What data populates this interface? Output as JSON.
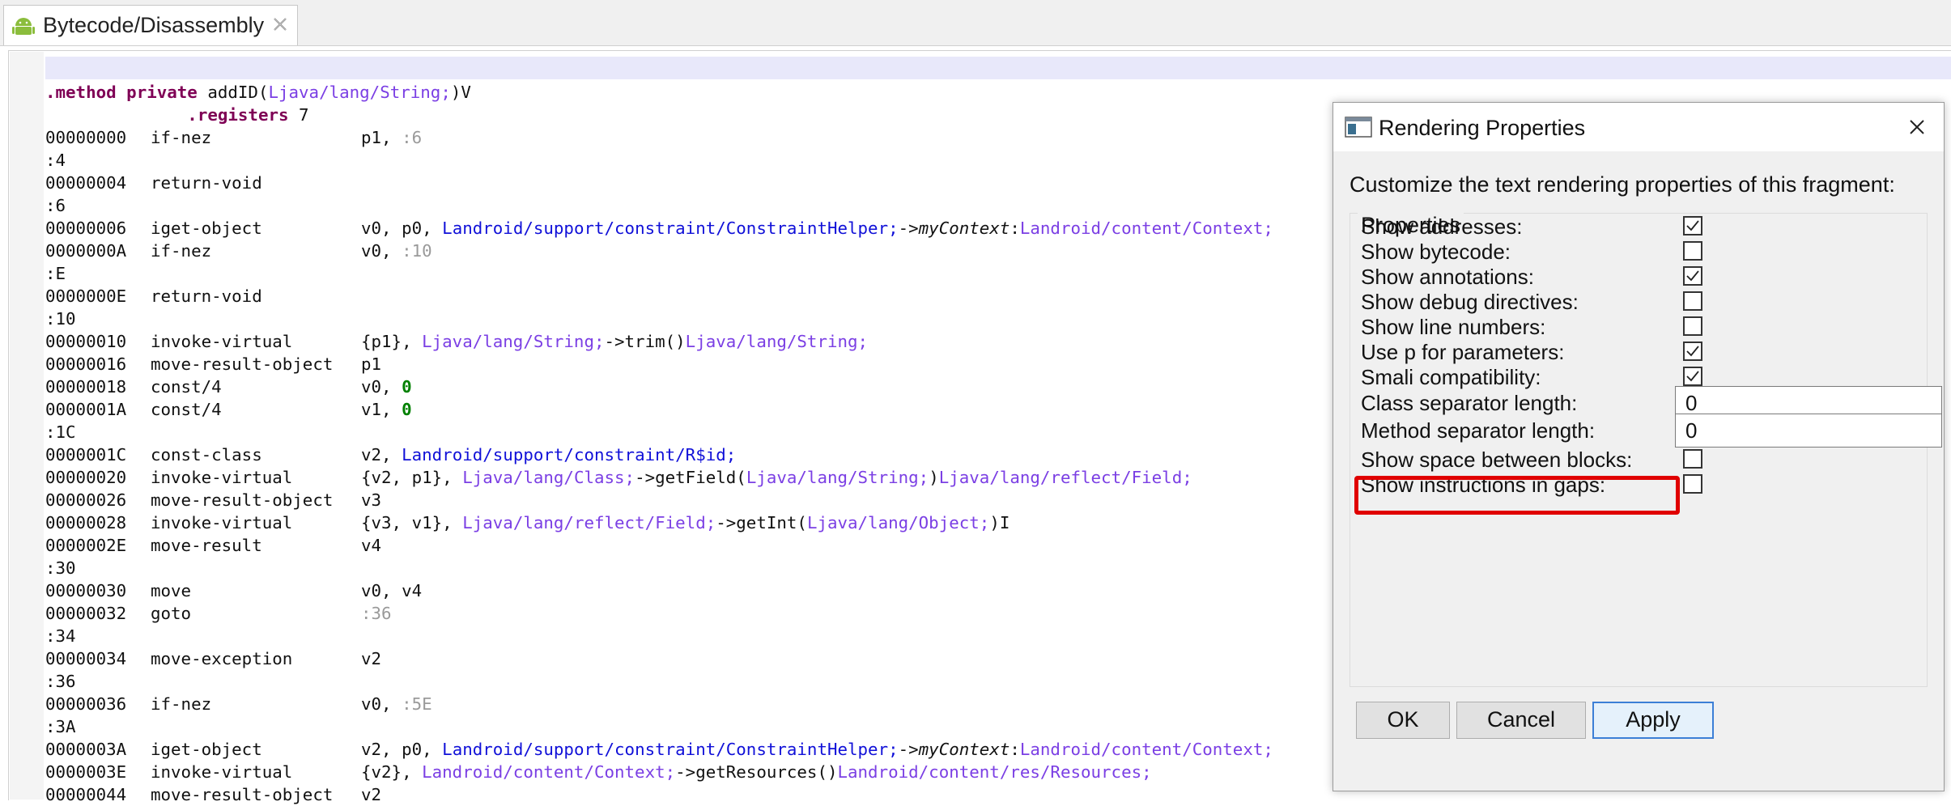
{
  "tab": {
    "title": "Bytecode/Disassembly"
  },
  "code": {
    "lines": [
      [
        {
          "t": ".method ",
          "c": "kw"
        },
        {
          "t": "private ",
          "c": "kw"
        },
        {
          "t": "addID("
        },
        {
          "t": "Ljava/lang/String;",
          "c": "type"
        },
        {
          "t": ")V"
        }
      ],
      [
        {
          "t": "              "
        },
        {
          "t": ".registers ",
          "c": "kw"
        },
        {
          "t": "7"
        }
      ],
      [
        {
          "t": "00000000",
          "c": "addr"
        },
        {
          "t": "if-nez",
          "c": "op"
        },
        {
          "t": "p1, "
        },
        {
          "t": ":6",
          "c": "lbl"
        }
      ],
      [
        {
          "t": ":4"
        }
      ],
      [
        {
          "t": "00000004",
          "c": "addr"
        },
        {
          "t": "return-void",
          "c": "op"
        }
      ],
      [
        {
          "t": ":6"
        }
      ],
      [
        {
          "t": "00000006",
          "c": "addr"
        },
        {
          "t": "iget-object",
          "c": "op"
        },
        {
          "t": "v0, p0, "
        },
        {
          "t": "Landroid/support/constraint/ConstraintHelper;",
          "c": "cls"
        },
        {
          "t": "->"
        },
        {
          "t": "myContext",
          "c": "fld"
        },
        {
          "t": ":"
        },
        {
          "t": "Landroid/content/Context;",
          "c": "type"
        }
      ],
      [
        {
          "t": "0000000A",
          "c": "addr"
        },
        {
          "t": "if-nez",
          "c": "op"
        },
        {
          "t": "v0, "
        },
        {
          "t": ":10",
          "c": "lbl"
        }
      ],
      [
        {
          "t": ":E"
        }
      ],
      [
        {
          "t": "0000000E",
          "c": "addr"
        },
        {
          "t": "return-void",
          "c": "op"
        }
      ],
      [
        {
          "t": ":10"
        }
      ],
      [
        {
          "t": "00000010",
          "c": "addr"
        },
        {
          "t": "invoke-virtual",
          "c": "op"
        },
        {
          "t": "{p1}, "
        },
        {
          "t": "Ljava/lang/String;",
          "c": "type"
        },
        {
          "t": "->trim()"
        },
        {
          "t": "Ljava/lang/String;",
          "c": "type"
        }
      ],
      [
        {
          "t": "00000016",
          "c": "addr"
        },
        {
          "t": "move-result-object",
          "c": "op"
        },
        {
          "t": "p1"
        }
      ],
      [
        {
          "t": "00000018",
          "c": "addr"
        },
        {
          "t": "const/4",
          "c": "op"
        },
        {
          "t": "v0, "
        },
        {
          "t": "0",
          "c": "num"
        }
      ],
      [
        {
          "t": "0000001A",
          "c": "addr"
        },
        {
          "t": "const/4",
          "c": "op"
        },
        {
          "t": "v1, "
        },
        {
          "t": "0",
          "c": "num"
        }
      ],
      [
        {
          "t": ":1C"
        }
      ],
      [
        {
          "t": "0000001C",
          "c": "addr"
        },
        {
          "t": "const-class",
          "c": "op"
        },
        {
          "t": "v2, "
        },
        {
          "t": "Landroid/support/constraint/R$id;",
          "c": "cls"
        }
      ],
      [
        {
          "t": "00000020",
          "c": "addr"
        },
        {
          "t": "invoke-virtual",
          "c": "op"
        },
        {
          "t": "{v2, p1}, "
        },
        {
          "t": "Ljava/lang/Class;",
          "c": "type"
        },
        {
          "t": "->getField("
        },
        {
          "t": "Ljava/lang/String;",
          "c": "type"
        },
        {
          "t": ")"
        },
        {
          "t": "Ljava/lang/reflect/Field;",
          "c": "type"
        }
      ],
      [
        {
          "t": "00000026",
          "c": "addr"
        },
        {
          "t": "move-result-object",
          "c": "op"
        },
        {
          "t": "v3"
        }
      ],
      [
        {
          "t": "00000028",
          "c": "addr"
        },
        {
          "t": "invoke-virtual",
          "c": "op"
        },
        {
          "t": "{v3, v1}, "
        },
        {
          "t": "Ljava/lang/reflect/Field;",
          "c": "type"
        },
        {
          "t": "->getInt("
        },
        {
          "t": "Ljava/lang/Object;",
          "c": "type"
        },
        {
          "t": ")I"
        }
      ],
      [
        {
          "t": "0000002E",
          "c": "addr"
        },
        {
          "t": "move-result",
          "c": "op"
        },
        {
          "t": "v4"
        }
      ],
      [
        {
          "t": ":30"
        }
      ],
      [
        {
          "t": "00000030",
          "c": "addr"
        },
        {
          "t": "move",
          "c": "op"
        },
        {
          "t": "v0, v4"
        }
      ],
      [
        {
          "t": "00000032",
          "c": "addr"
        },
        {
          "t": "goto",
          "c": "op"
        },
        {
          "t": ":36",
          "c": "lbl"
        }
      ],
      [
        {
          "t": ":34"
        }
      ],
      [
        {
          "t": "00000034",
          "c": "addr"
        },
        {
          "t": "move-exception",
          "c": "op"
        },
        {
          "t": "v2"
        }
      ],
      [
        {
          "t": ":36"
        }
      ],
      [
        {
          "t": "00000036",
          "c": "addr"
        },
        {
          "t": "if-nez",
          "c": "op"
        },
        {
          "t": "v0, "
        },
        {
          "t": ":5E",
          "c": "lbl"
        }
      ],
      [
        {
          "t": ":3A"
        }
      ],
      [
        {
          "t": "0000003A",
          "c": "addr"
        },
        {
          "t": "iget-object",
          "c": "op"
        },
        {
          "t": "v2, p0, "
        },
        {
          "t": "Landroid/support/constraint/ConstraintHelper;",
          "c": "cls"
        },
        {
          "t": "->"
        },
        {
          "t": "myContext",
          "c": "fld"
        },
        {
          "t": ":"
        },
        {
          "t": "Landroid/content/Context;",
          "c": "type"
        }
      ],
      [
        {
          "t": "0000003E",
          "c": "addr"
        },
        {
          "t": "invoke-virtual",
          "c": "op"
        },
        {
          "t": "{v2}, "
        },
        {
          "t": "Landroid/content/Context;",
          "c": "type"
        },
        {
          "t": "->getResources()"
        },
        {
          "t": "Landroid/content/res/Resources;",
          "c": "type"
        }
      ],
      [
        {
          "t": "00000044",
          "c": "addr"
        },
        {
          "t": "move-result-object",
          "c": "op"
        },
        {
          "t": "v2"
        }
      ]
    ]
  },
  "dialog": {
    "title": "Rendering Properties",
    "description": "Customize the text rendering properties of this fragment:",
    "group_title": "Properties",
    "properties": [
      {
        "label": "Show addresses:",
        "type": "checkbox",
        "checked": true
      },
      {
        "label": "Show bytecode:",
        "type": "checkbox",
        "checked": false
      },
      {
        "label": "Show annotations:",
        "type": "checkbox",
        "checked": true
      },
      {
        "label": "Show debug directives:",
        "type": "checkbox",
        "checked": false
      },
      {
        "label": "Show line numbers:",
        "type": "checkbox",
        "checked": false
      },
      {
        "label": "Use p for parameters:",
        "type": "checkbox",
        "checked": true
      },
      {
        "label": "Smali compatibility:",
        "type": "checkbox",
        "checked": true
      },
      {
        "label": "Class separator length:",
        "type": "text",
        "value": "0"
      },
      {
        "label": "Method separator length:",
        "type": "text",
        "value": "0"
      },
      {
        "label": "Show space between blocks:",
        "type": "checkbox",
        "checked": false
      },
      {
        "label": "Show instructions in gaps:",
        "type": "checkbox",
        "checked": false
      }
    ],
    "buttons": {
      "ok": "OK",
      "cancel": "Cancel",
      "apply": "Apply"
    }
  },
  "colors": {
    "highlight": "#e00000",
    "android": "#8bbd3c",
    "apply_border": "#3c7fd6"
  }
}
